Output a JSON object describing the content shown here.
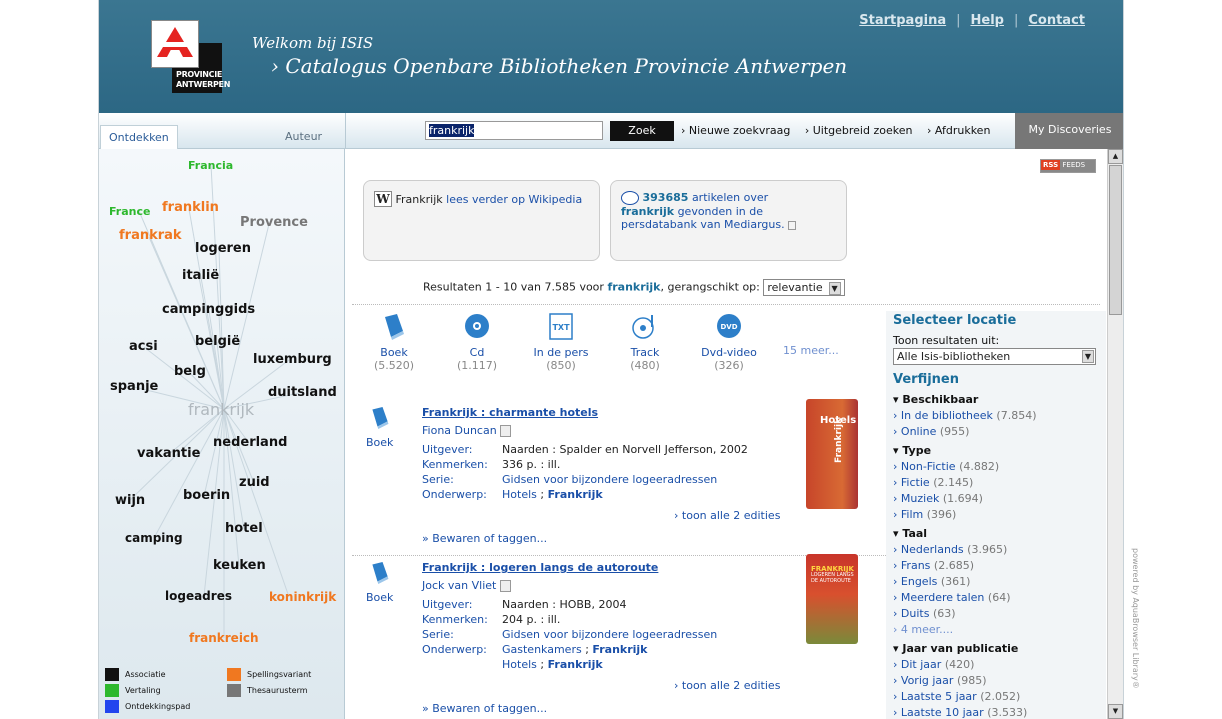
{
  "header": {
    "logo_text_1": "PROVINCIE",
    "logo_text_2": "ANTWERPEN",
    "welcome": "Welkom bij ISIS",
    "catalog_title": "› Catalogus Openbare Bibliotheken Provincie Antwerpen",
    "links": [
      "Startpagina",
      "Help",
      "Contact"
    ],
    "separator": "|"
  },
  "navbar": {
    "tab_discover": "Ontdekken",
    "tab_author": "Auteur",
    "search_value": "frankrijk",
    "search_button": "Zoek",
    "links": [
      "› Nieuwe zoekvraag",
      "› Uitgebreid zoeken",
      "› Afdrukken"
    ],
    "my_discoveries": "My Discoveries"
  },
  "cloud": {
    "center": "frankrijk",
    "words": [
      {
        "t": "Francia",
        "c": "#2db82d"
      },
      {
        "t": "France",
        "c": "#2db82d"
      },
      {
        "t": "franklin",
        "c": "#f07820"
      },
      {
        "t": "Provence",
        "c": "#777777"
      },
      {
        "t": "frankrak",
        "c": "#f07820"
      },
      {
        "t": "logeren",
        "c": "#111111"
      },
      {
        "t": "italië",
        "c": "#111111"
      },
      {
        "t": "campinggids",
        "c": "#111111"
      },
      {
        "t": "acsi",
        "c": "#111111"
      },
      {
        "t": "belgië",
        "c": "#111111"
      },
      {
        "t": "luxemburg",
        "c": "#111111"
      },
      {
        "t": "belg",
        "c": "#111111"
      },
      {
        "t": "spanje",
        "c": "#111111"
      },
      {
        "t": "duitsland",
        "c": "#111111"
      },
      {
        "t": "nederland",
        "c": "#111111"
      },
      {
        "t": "vakantie",
        "c": "#111111"
      },
      {
        "t": "zuid",
        "c": "#111111"
      },
      {
        "t": "wijn",
        "c": "#111111"
      },
      {
        "t": "boerin",
        "c": "#111111"
      },
      {
        "t": "hotel",
        "c": "#111111"
      },
      {
        "t": "camping",
        "c": "#111111"
      },
      {
        "t": "keuken",
        "c": "#111111"
      },
      {
        "t": "logeadres",
        "c": "#111111"
      },
      {
        "t": "koninkrijk",
        "c": "#f07820"
      },
      {
        "t": "frankreich",
        "c": "#f07820"
      }
    ],
    "legend": [
      {
        "label": "Associatie",
        "color": "#111111"
      },
      {
        "label": "Spellingsvariant",
        "color": "#f07820"
      },
      {
        "label": "Vertaling",
        "color": "#2db82d"
      },
      {
        "label": "Thesaurusterm",
        "color": "#777777"
      },
      {
        "label": "Ontdekkingspad",
        "color": "#2244ee"
      }
    ]
  },
  "content": {
    "rss": "RSS",
    "feeds": "FEEDS",
    "wiki": {
      "icon": "W",
      "term": "Frankrijk",
      "link": "lees verder op Wikipedia"
    },
    "press": {
      "count": "393685",
      "text1": "artikelen over",
      "term": "frankrijk",
      "text2": "gevonden in de persdatabank van Mediargus."
    },
    "results_prefix": "Resultaten 1 - 10 van 7.585 voor",
    "results_term": "frankrijk",
    "results_suffix": ", gerangschikt op:",
    "sort_value": "relevantie",
    "formats": [
      {
        "label": "Boek",
        "count": "(5.520)"
      },
      {
        "label": "Cd",
        "count": "(1.117)"
      },
      {
        "label": "In de pers",
        "count": "(850)"
      },
      {
        "label": "Track",
        "count": "(480)"
      },
      {
        "label": "Dvd-video",
        "count": "(326)"
      }
    ],
    "more_formats": "15 meer...",
    "results": [
      {
        "type": "Boek",
        "title": "Frankrijk : charmante hotels",
        "author": "Fiona Duncan",
        "uitgever_k": "Uitgever:",
        "uitgever": "Naarden : Spalder en Norvell Jefferson, 2002",
        "kenmerken_k": "Kenmerken:",
        "kenmerken": "336 p. : ill.",
        "serie_k": "Serie:",
        "serie": "Gidsen voor bijzondere logeeradressen",
        "onderwerp_k": "Onderwerp:",
        "onderwerp_1": "Hotels",
        "onderwerp_2": "Frankrijk",
        "onderwerp_3": "",
        "onderwerp_4": "",
        "editions": "› toon alle 2 edities",
        "save": "» Bewaren of taggen...",
        "cover_title": "Hotels",
        "cover_side": "Frankrijk"
      },
      {
        "type": "Boek",
        "title": "Frankrijk : logeren langs de autoroute",
        "author": "Jock van Vliet",
        "uitgever_k": "Uitgever:",
        "uitgever": "Naarden : HOBB, 2004",
        "kenmerken_k": "Kenmerken:",
        "kenmerken": "204 p. : ill.",
        "serie_k": "Serie:",
        "serie": "Gidsen voor bijzondere logeeradressen",
        "onderwerp_k": "Onderwerp:",
        "onderwerp_1": "Gastenkamers",
        "onderwerp_2": "Frankrijk",
        "onderwerp_3": "Hotels",
        "onderwerp_4": "Frankrijk",
        "editions": "› toon alle 2 edities",
        "save": "» Bewaren of taggen...",
        "cover_title": "FRANKRIJK",
        "cover_side": "LOGEREN LANGS DE AUTOROUTE"
      }
    ]
  },
  "sidebar": {
    "location_heading": "Selecteer locatie",
    "show_results": "Toon resultaten uit:",
    "location_value": "Alle Isis-bibliotheken",
    "refine_heading": "Verfijnen",
    "groups": [
      {
        "title": "Beschikbaar",
        "items": [
          [
            "In de bibliotheek",
            "(7.854)"
          ],
          [
            "Online",
            "(955)"
          ]
        ]
      },
      {
        "title": "Type",
        "items": [
          [
            "Non-Fictie",
            "(4.882)"
          ],
          [
            "Fictie",
            "(2.145)"
          ],
          [
            "Muziek",
            "(1.694)"
          ],
          [
            "Film",
            "(396)"
          ]
        ]
      },
      {
        "title": "Taal",
        "items": [
          [
            "Nederlands",
            "(3.965)"
          ],
          [
            "Frans",
            "(2.685)"
          ],
          [
            "Engels",
            "(361)"
          ],
          [
            "Meerdere talen",
            "(64)"
          ],
          [
            "Duits",
            "(63)"
          ]
        ],
        "more": "4 meer...."
      },
      {
        "title": "Jaar van publicatie",
        "items": [
          [
            "Dit jaar",
            "(420)"
          ],
          [
            "Vorig jaar",
            "(985)"
          ],
          [
            "Laatste 5 jaar",
            "(2.052)"
          ],
          [
            "Laatste 10 jaar",
            "(3.533)"
          ]
        ]
      }
    ]
  },
  "powered": "powered by AquaBrowser Library®"
}
